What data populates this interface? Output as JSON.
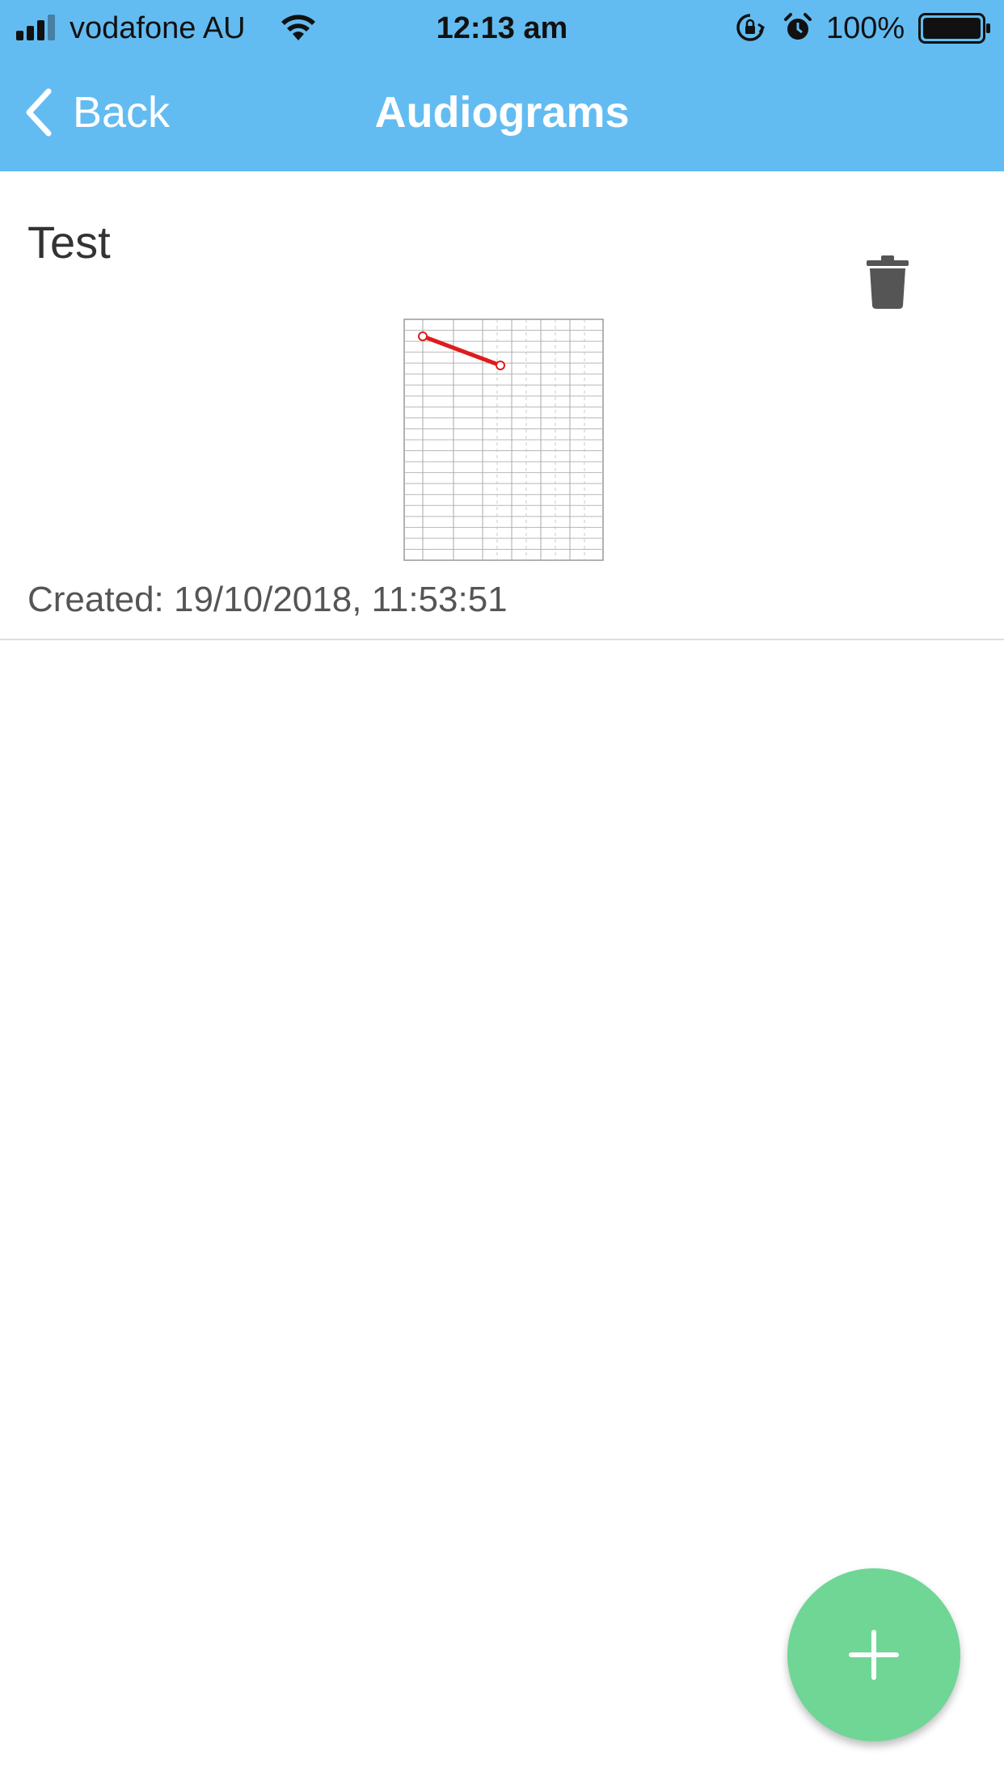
{
  "status_bar": {
    "carrier": "vodafone AU",
    "time": "12:13 am",
    "battery": "100%"
  },
  "nav": {
    "back_label": "Back",
    "title": "Audiograms"
  },
  "audiograms": [
    {
      "name": "Test",
      "created": "Created: 19/10/2018, 11:53:51"
    }
  ],
  "colors": {
    "header": "#63bcf1",
    "fab": "#6fd696",
    "trace": "#e01b1b"
  }
}
